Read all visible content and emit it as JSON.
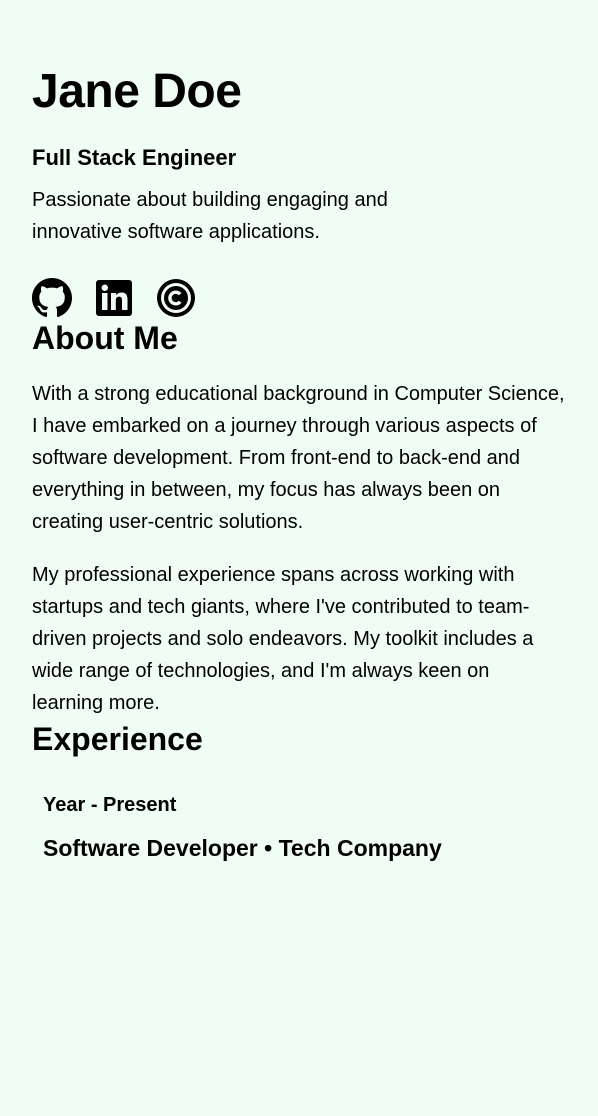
{
  "header": {
    "name": "Jane Doe",
    "role": "Full Stack Engineer",
    "tagline": "Passionate about building engaging and innovative software applications."
  },
  "socials": [
    {
      "icon": "github-icon"
    },
    {
      "icon": "linkedin-icon"
    },
    {
      "icon": "codepen-icon"
    }
  ],
  "about": {
    "title": "About Me",
    "paragraphs": [
      "With a strong educational background in Computer Science, I have embarked on a journey through various aspects of software development. From front-end to back-end and everything in between, my focus has always been on creating user-centric solutions.",
      "My professional experience spans across working with startups and tech giants, where I've contributed to team-driven projects and solo endeavors. My toolkit includes a wide range of technologies, and I'm always keen on learning more."
    ]
  },
  "experience": {
    "title": "Experience",
    "items": [
      {
        "period": "Year - Present",
        "role": "Software Developer",
        "separator": "•",
        "company": "Tech Company"
      }
    ]
  },
  "colors": {
    "background": "#f0fdf4",
    "text": "#000000"
  }
}
